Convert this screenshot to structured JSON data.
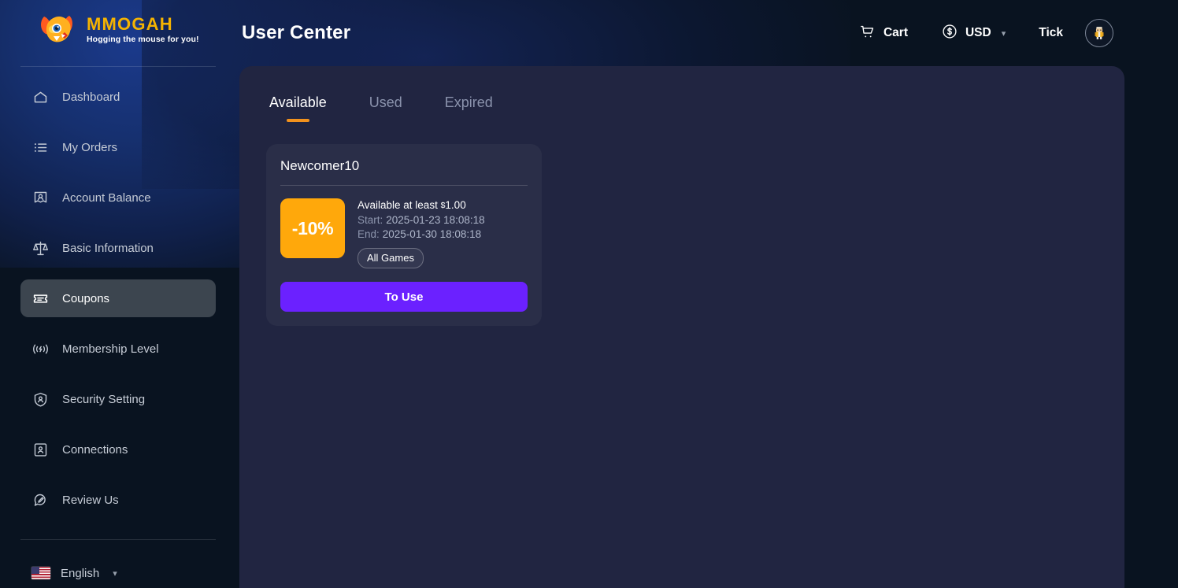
{
  "brand": {
    "name": "MMOGAH",
    "tagline": "Hogging the mouse for you!",
    "logo_color": "#F5B301"
  },
  "header": {
    "title": "User Center",
    "cart_label": "Cart",
    "currency_label": "USD",
    "user_label": "Tick",
    "icons": {
      "cart": "cart-icon",
      "currency": "dollar-circle-icon",
      "chevron": "chevron-down-icon",
      "avatar": "avatar-icon"
    }
  },
  "sidebar": {
    "items": [
      {
        "label": "Dashboard",
        "icon": "home-icon",
        "active": false
      },
      {
        "label": "My Orders",
        "icon": "list-icon",
        "active": false
      },
      {
        "label": "Account Balance",
        "icon": "wallet-user-icon",
        "active": false
      },
      {
        "label": "Basic Information",
        "icon": "scales-icon",
        "active": false
      },
      {
        "label": "Coupons",
        "icon": "ticket-icon",
        "active": true
      },
      {
        "label": "Membership Level",
        "icon": "signal-icon",
        "active": false
      },
      {
        "label": "Security Setting",
        "icon": "shield-user-icon",
        "active": false
      },
      {
        "label": "Connections",
        "icon": "id-card-icon",
        "active": false
      },
      {
        "label": "Review Us",
        "icon": "chat-pencil-icon",
        "active": false
      }
    ],
    "language": {
      "label": "English",
      "flag": "us-flag-icon",
      "chevron": "chevron-down-icon"
    }
  },
  "main": {
    "tabs": [
      {
        "label": "Available",
        "active": true
      },
      {
        "label": "Used",
        "active": false
      },
      {
        "label": "Expired",
        "active": false
      }
    ],
    "active_tab_accent": "#F2921D",
    "coupons": [
      {
        "title": "Newcomer10",
        "discount": "-10%",
        "discount_color": "#FFA80B",
        "minimum_label": "Available at least ",
        "minimum_currency": "$",
        "minimum_value": "1.00",
        "start_label": "Start:",
        "start_value": "2025-01-23 18:08:18",
        "end_label": "End:",
        "end_value": "2025-01-30 18:08:18",
        "scope": "All Games",
        "action_label": "To Use",
        "action_color": "#6B21FF"
      }
    ]
  }
}
